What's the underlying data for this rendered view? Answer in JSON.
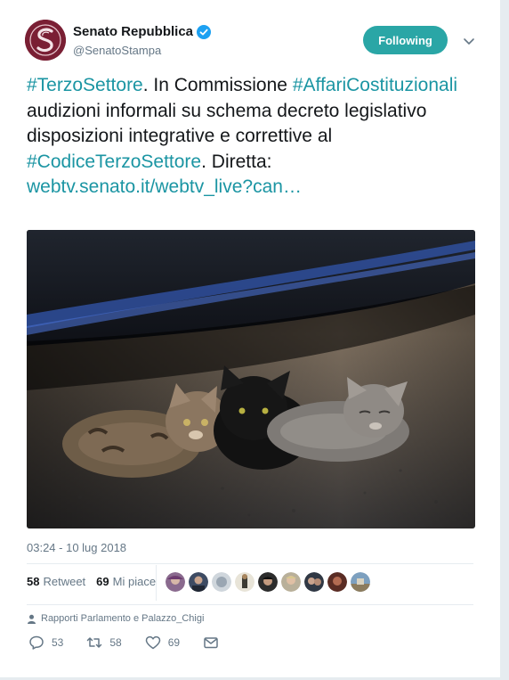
{
  "account": {
    "display_name": "Senato Repubblica",
    "handle": "@SenatoStampa",
    "avatar_icon": "senato-logo-icon",
    "verified_icon": "verified-badge-icon"
  },
  "follow_button": {
    "label": "Following",
    "color": "#2aa6a6"
  },
  "tweet": {
    "t1": "#TerzoSettore",
    "t2": ". In Commissione ",
    "t3": "#AffariCostituzionali",
    "t4": " audizioni informali su schema decreto legislativo disposizioni integrative e correttive al ",
    "t5": "#CodiceTerzoSettore",
    "t6": ". Diretta: ",
    "t7": "webtv.senato.it/webtv_live?can…",
    "link_color": "#1b95a3"
  },
  "media": {
    "subject": "three kittens lying on pavement under a car"
  },
  "timestamp": "03:24 - 10 lug 2018",
  "stats": {
    "retweets_count": "58",
    "retweets_label": "Retweet",
    "likes_count": "69",
    "likes_label": "Mi piace"
  },
  "likers_count_shown": 9,
  "context": {
    "icon": "person-icon",
    "label": "Rapporti Parlamento e Palazzo_Chigi"
  },
  "actions": {
    "reply_count": "53",
    "retweet_count": "58",
    "like_count": "69"
  }
}
